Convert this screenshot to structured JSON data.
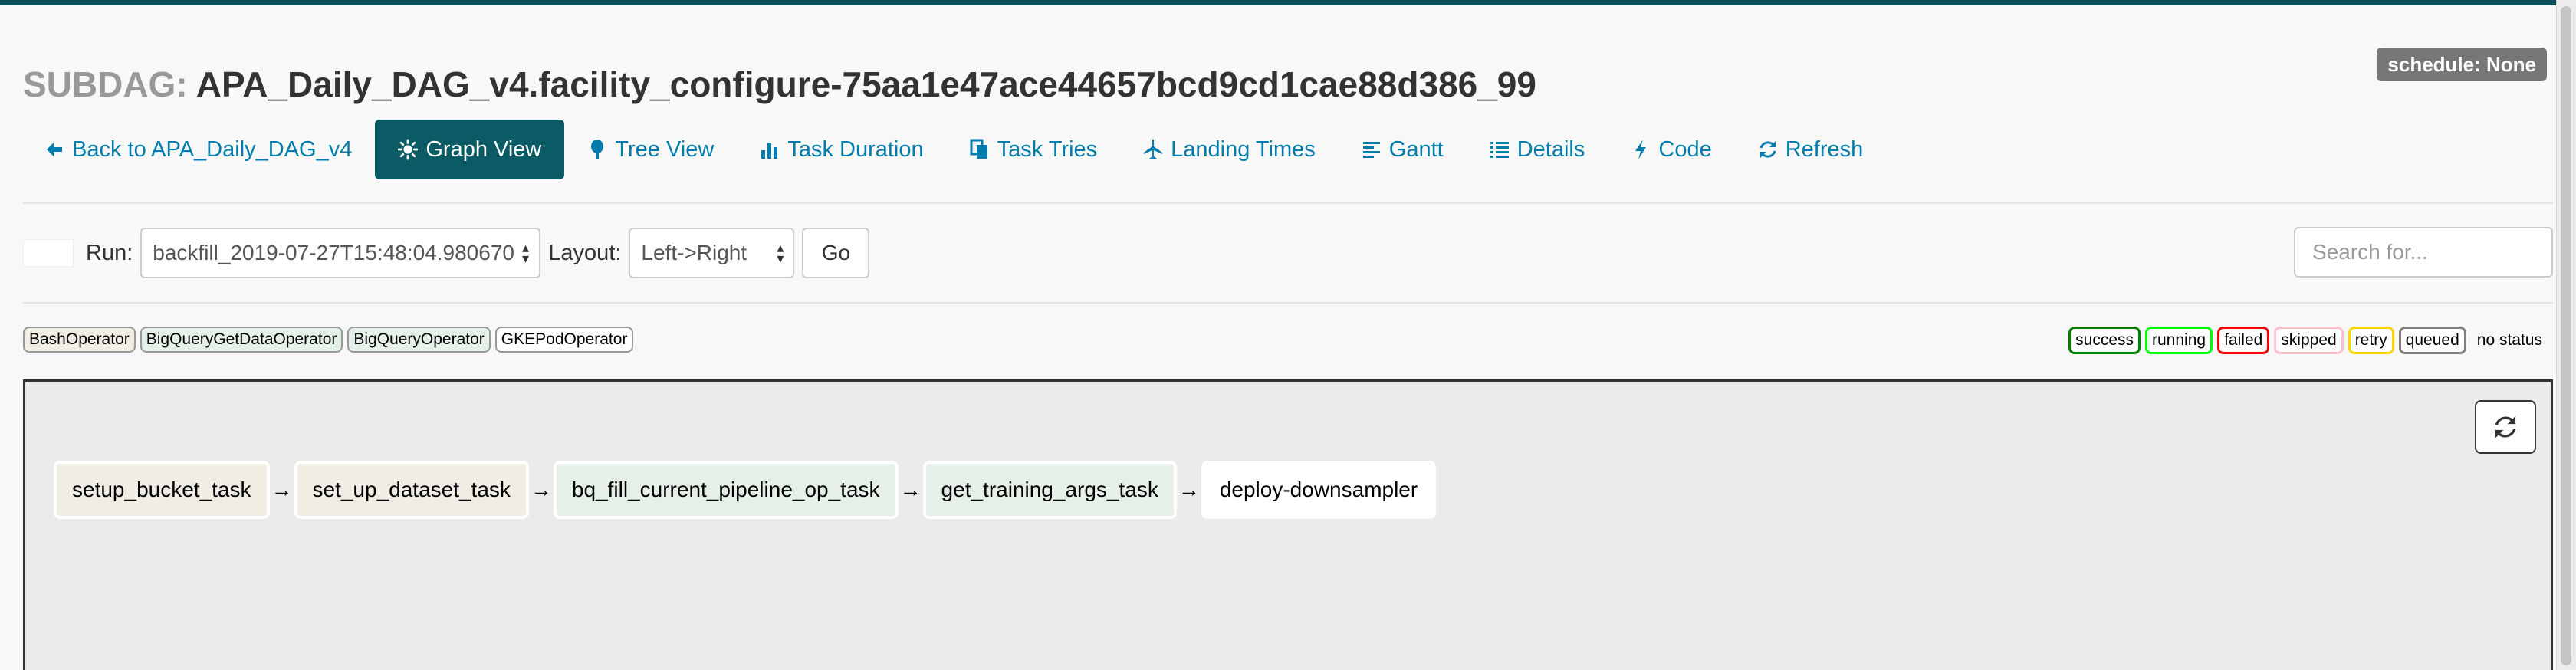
{
  "header": {
    "title_prefix": "SUBDAG:",
    "title": "APA_Daily_DAG_v4.facility_configure-75aa1e47ace44657bcd9cd1cae88d386_99",
    "schedule_badge": "schedule: None"
  },
  "nav": {
    "back": "Back to APA_Daily_DAG_v4",
    "graph": "Graph View",
    "tree": "Tree View",
    "duration": "Task Duration",
    "tries": "Task Tries",
    "landing": "Landing Times",
    "gantt": "Gantt",
    "details": "Details",
    "code": "Code",
    "refresh": "Refresh"
  },
  "controls": {
    "run_label": "Run:",
    "run_value": "backfill_2019-07-27T15:48:04.980670",
    "layout_label": "Layout:",
    "layout_value": "Left->Right",
    "go_label": "Go",
    "search_placeholder": "Search for..."
  },
  "operators": [
    {
      "label": "BashOperator",
      "color": "#f0ede4"
    },
    {
      "label": "BigQueryGetDataOperator",
      "color": "#e4f0e8"
    },
    {
      "label": "BigQueryOperator",
      "color": "#e4f0e8"
    },
    {
      "label": "GKEPodOperator",
      "color": "#ffffff"
    }
  ],
  "states": [
    {
      "label": "success",
      "color": "#008000"
    },
    {
      "label": "running",
      "color": "#00ff00"
    },
    {
      "label": "failed",
      "color": "#ff0000"
    },
    {
      "label": "skipped",
      "color": "#ffc0cb"
    },
    {
      "label": "retry",
      "color": "#ffd700"
    },
    {
      "label": "queued",
      "color": "#808080"
    }
  ],
  "no_status_label": "no status",
  "tasks": [
    {
      "label": "setup_bucket_task",
      "color": "#f0ede4"
    },
    {
      "label": "set_up_dataset_task",
      "color": "#f0ede4"
    },
    {
      "label": "bq_fill_current_pipeline_op_task",
      "color": "#e4f0e8"
    },
    {
      "label": "get_training_args_task",
      "color": "#e4f0e8"
    },
    {
      "label": "deploy-downsampler",
      "color": "#ffffff"
    }
  ],
  "colors": {
    "accent": "#017cac",
    "active_nav": "#0a5b66",
    "top_bar": "#0a4e5a"
  },
  "icons": {
    "back": "arrow-left-icon",
    "graph": "sun-icon",
    "tree": "tree-icon",
    "duration": "bar-chart-icon",
    "tries": "copy-icon",
    "landing": "plane-icon",
    "gantt": "align-left-icon",
    "details": "list-icon",
    "code": "bolt-icon",
    "refresh": "refresh-icon"
  }
}
